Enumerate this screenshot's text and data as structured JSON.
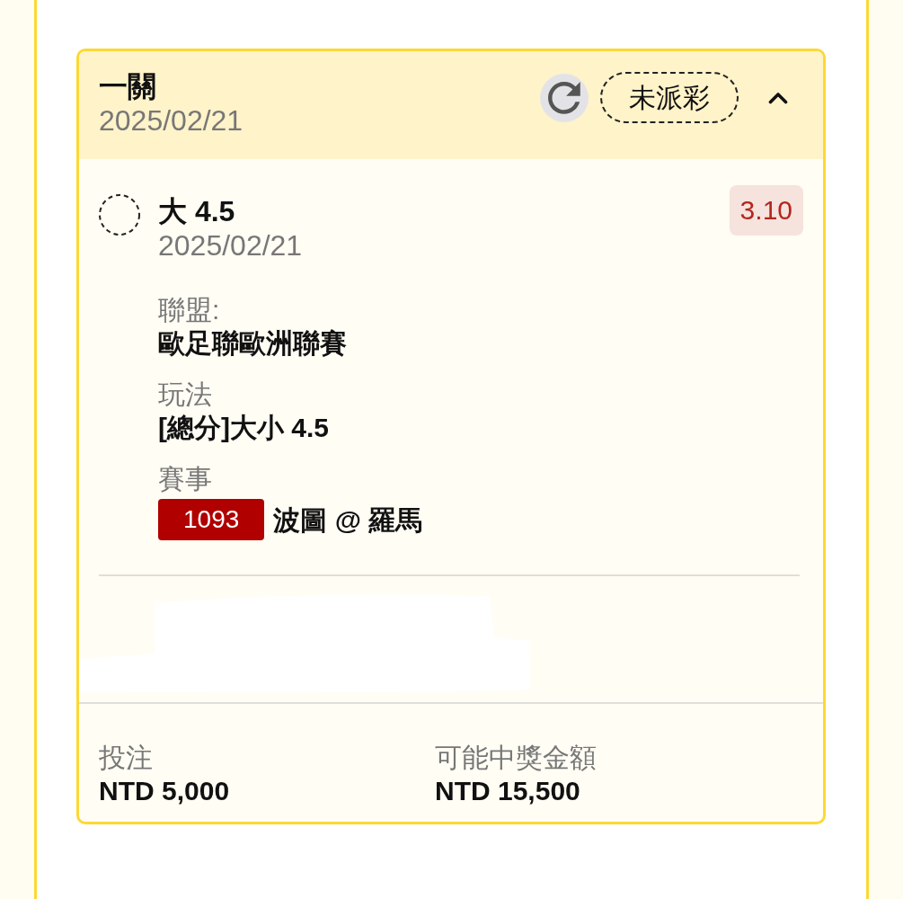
{
  "ticket": {
    "title": "一關",
    "date": "2025/02/21",
    "status": "未派彩",
    "expanded": true
  },
  "selections": [
    {
      "pick": "大 4.5",
      "date": "2025/02/21",
      "odds": "3.10",
      "details": [
        {
          "kind": "text",
          "label": "聯盟:",
          "value": "歐足聯歐洲聯賽"
        },
        {
          "kind": "text",
          "label": "玩法",
          "value": "[總分]大小 4.5"
        },
        {
          "kind": "match",
          "label": "賽事",
          "match_no": "1093",
          "value": "波圖 @ 羅馬"
        }
      ]
    }
  ],
  "summary": [
    {
      "label": "投注",
      "value": "NTD 5,000"
    },
    {
      "label": "可能中獎金額",
      "value": "NTD 15,500"
    }
  ]
}
